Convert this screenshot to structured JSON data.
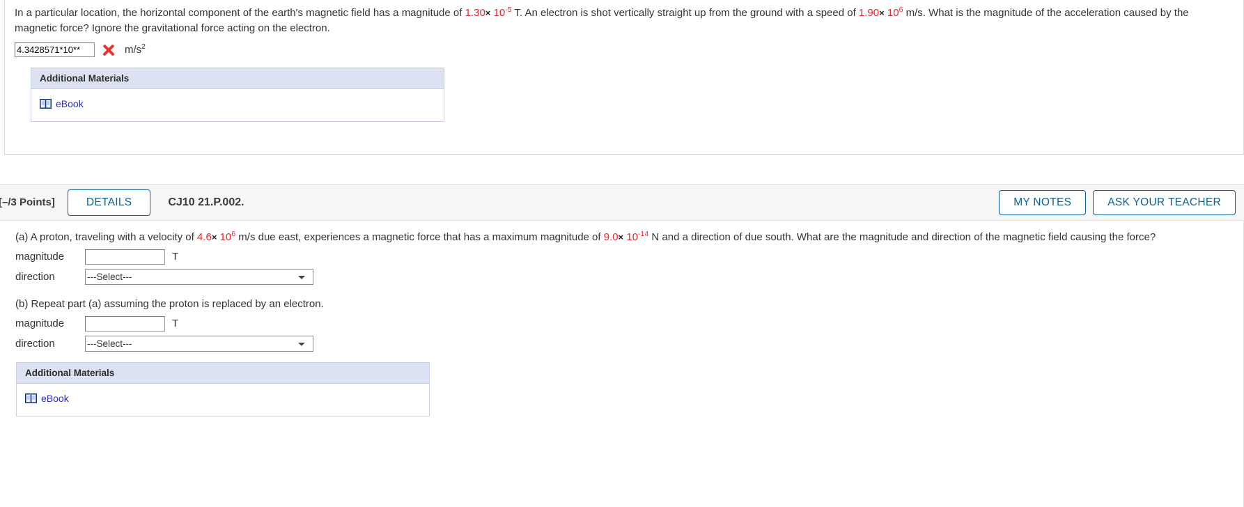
{
  "question1": {
    "text_part1": "In a particular location, the horizontal component of the earth's magnetic field has a magnitude of ",
    "value1": "1.30",
    "times": "×",
    "exp1_base": "10",
    "exp1_sup": "-5",
    "text_part2": " T. An electron is shot vertically straight up from the ground with a speed of ",
    "value2": "1.90",
    "exp2_base": "10",
    "exp2_sup": "6",
    "text_part3": " m/s. What is the magnitude of the acceleration caused by the magnetic force? Ignore the gravitational force acting on the electron.",
    "answer_value": "4.3428571*10**",
    "answer_status_icon": "incorrect-x-icon",
    "unit_base": "m/s",
    "unit_sup": "2",
    "additional_materials": {
      "header": "Additional Materials",
      "ebook_label": "eBook",
      "ebook_icon": "book-icon"
    }
  },
  "question2": {
    "header": {
      "points": "[–/3 Points]",
      "details_label": "DETAILS",
      "question_code": "CJ10 21.P.002.",
      "my_notes_label": "MY NOTES",
      "ask_teacher_label": "ASK YOUR TEACHER"
    },
    "part_a": {
      "text_part1": "(a) A proton, traveling with a velocity of ",
      "value1": "4.6",
      "times": "×",
      "exp1_base": "10",
      "exp1_sup": "6",
      "text_part2": " m/s due east, experiences a magnetic force that has a maximum magnitude of ",
      "value2": "9.0",
      "exp2_base": "10",
      "exp2_sup": "-14",
      "text_part3": " N and a direction of due south. What are the magnitude and direction of the magnetic field causing the force?",
      "magnitude_label": "magnitude",
      "magnitude_value": "",
      "magnitude_unit": "T",
      "direction_label": "direction",
      "direction_selected": "---Select---",
      "direction_options": [
        "---Select---"
      ]
    },
    "part_b": {
      "text": "(b) Repeat part (a) assuming the proton is replaced by an electron.",
      "magnitude_label": "magnitude",
      "magnitude_value": "",
      "magnitude_unit": "T",
      "direction_label": "direction",
      "direction_selected": "---Select---",
      "direction_options": [
        "---Select---"
      ]
    },
    "additional_materials": {
      "header": "Additional Materials",
      "ebook_label": "eBook",
      "ebook_icon": "book-icon"
    }
  },
  "colors": {
    "accent_blue": "#0b6292",
    "value_red": "#e8232a",
    "link_blue": "#2b2bc7",
    "panel_header_bg": "#dce2f2",
    "header_bar_bg": "#f6f6f6"
  }
}
